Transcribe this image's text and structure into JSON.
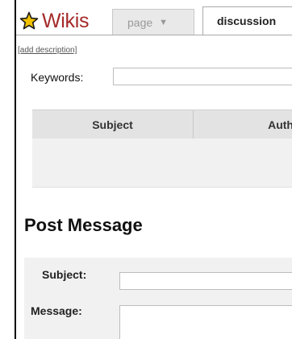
{
  "app": {
    "title": "Wikis",
    "logo_icon": "star-icon"
  },
  "tabs": [
    {
      "label": "page",
      "icon": "caret-down-icon",
      "active": false
    },
    {
      "label": "discussion",
      "active": true
    }
  ],
  "description": {
    "link": "[add description]"
  },
  "keywords": {
    "label": "Keywords:",
    "value": ""
  },
  "table": {
    "columns": [
      "Subject",
      "Author"
    ],
    "rows": []
  },
  "post": {
    "heading": "Post Message",
    "subject_label": "Subject:",
    "subject_value": "",
    "message_label": "Message:",
    "message_value": ""
  },
  "colors": {
    "brand": "#a52a2a",
    "star": "#f2c200",
    "header_bg": "#e3e3e3",
    "panel_bg": "#f1f1f1"
  }
}
